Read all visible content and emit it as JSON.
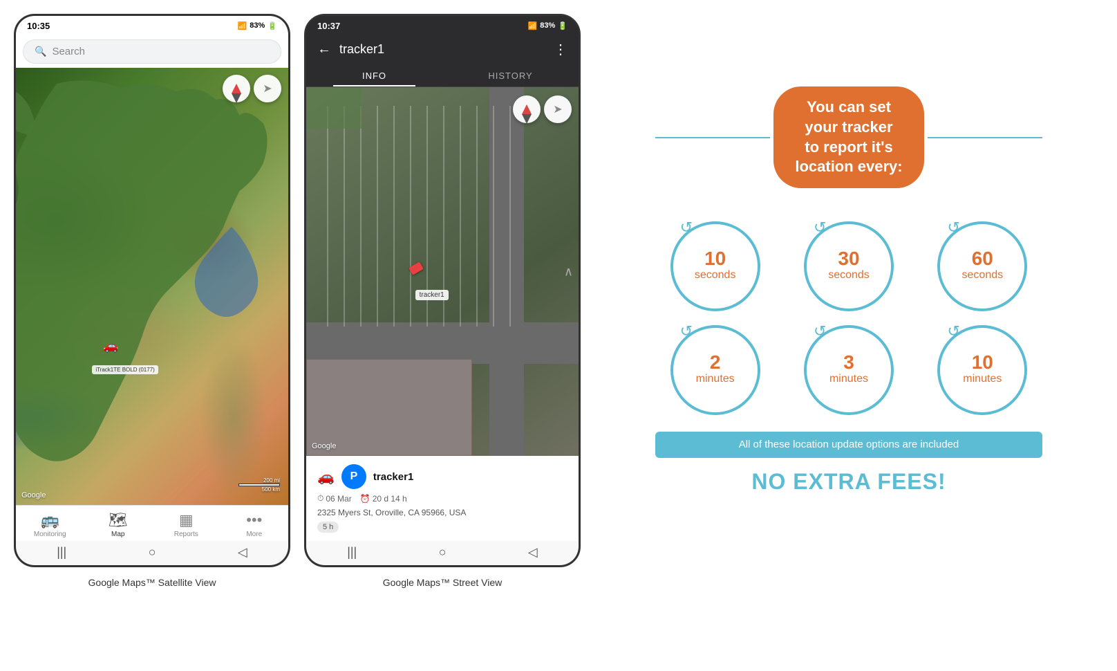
{
  "phone1": {
    "status": {
      "time": "10:35",
      "signal": "📶",
      "battery": "83%",
      "battery_icon": "🔋"
    },
    "search_placeholder": "Search",
    "map_label": "iTrack1TE BOLD (0177)",
    "google_logo": "Google",
    "scale_top": "200 mi",
    "scale_bottom": "500 km",
    "nav_items": [
      {
        "icon": "🚌",
        "label": "Monitoring",
        "active": false
      },
      {
        "icon": "🗺",
        "label": "Map",
        "active": true
      },
      {
        "icon": "📊",
        "label": "Reports",
        "active": false
      },
      {
        "icon": "•••",
        "label": "More",
        "active": false
      }
    ],
    "caption": "Google Maps™ Satellite View"
  },
  "phone2": {
    "status": {
      "time": "10:37",
      "signal": "📶",
      "battery": "83%"
    },
    "tracker_name": "tracker1",
    "tabs": [
      {
        "label": "INFO",
        "active": true
      },
      {
        "label": "HISTORY",
        "active": false
      }
    ],
    "google_logo": "Google",
    "info": {
      "name": "tracker1",
      "avatar_letter": "P",
      "date": "06 Mar",
      "duration": "20 d 14 h",
      "address": "2325 Myers St, Oroville, CA 95966, USA",
      "badge": "5 h"
    },
    "caption": "Google Maps™ Street View"
  },
  "right_panel": {
    "headline_line1": "You can set your tracker",
    "headline_line2": "to report it's location every:",
    "circles": [
      {
        "number": "10",
        "unit": "seconds"
      },
      {
        "number": "30",
        "unit": "seconds"
      },
      {
        "number": "60",
        "unit": "seconds"
      },
      {
        "number": "2",
        "unit": "minutes"
      },
      {
        "number": "3",
        "unit": "minutes"
      },
      {
        "number": "10",
        "unit": "minutes"
      }
    ],
    "included_label": "All of these location update options are included",
    "no_fees_label": "NO EXTRA FEES!"
  }
}
